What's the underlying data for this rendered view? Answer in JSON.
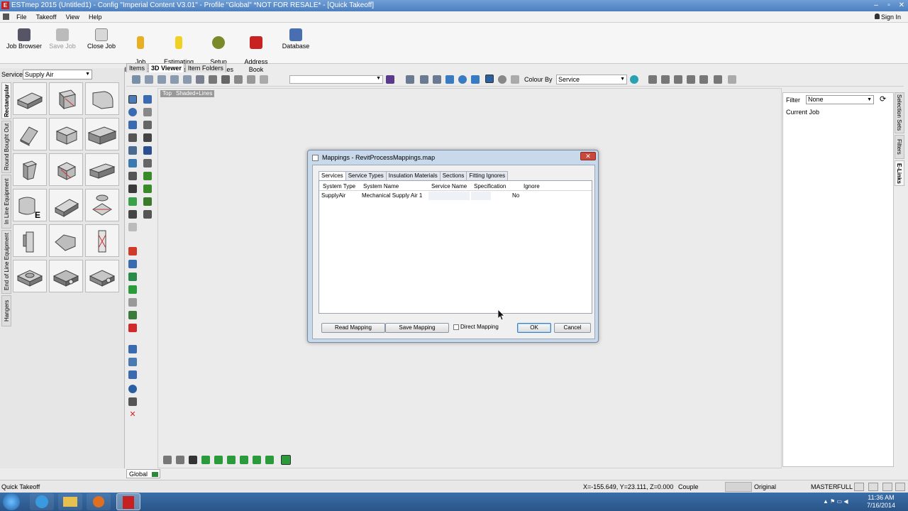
{
  "window": {
    "title": "ESTmep 2015 (Untitled1) - Config \"Imperial Content V3.01\" - Profile \"Global\" *NOT FOR RESALE* - [Quick Takeoff]",
    "controls": [
      "–",
      "▫",
      "✕"
    ]
  },
  "menu": {
    "items": [
      "File",
      "Takeoff",
      "View",
      "Help"
    ],
    "sign_in": "Sign In"
  },
  "ribbon": {
    "job_browser": "Job Browser",
    "save_job": "Save Job",
    "close_job": "Close Job",
    "job_information": "Job\nInformation",
    "estimating_summary": "Estimating\nSummary",
    "setup_processes": "Setup\nProcesses",
    "address_book": "Address\nBook",
    "database": "Database"
  },
  "left_panel": {
    "service_label": "Service",
    "service_value": "Supply Air",
    "vertical_tabs": [
      "Rectangular",
      "Round Bought Out",
      "In Line Equipment",
      "End of Line Equipment",
      "Hangers"
    ]
  },
  "view_tabs": [
    "Items",
    "3D Viewer",
    "Item Folders"
  ],
  "view_toolbar": {
    "colour_by_label": "Colour By",
    "colour_by_value": "Service"
  },
  "viewport": {
    "top_chip": "Top",
    "mode_chip": "Shaded+Lines"
  },
  "right_panel": {
    "filter_label": "Filter",
    "filter_value": "None",
    "current_job": "Current Job",
    "vertical_tabs": [
      "Selection Sets",
      "Filters",
      "E-Links"
    ]
  },
  "global_tab": "Global",
  "dialog": {
    "title": "Mappings - RevitProcessMappings.map",
    "tabs": [
      "Services",
      "Service Types",
      "Insulation Materials",
      "Sections",
      "Fitting Ignores"
    ],
    "columns": [
      "System Type",
      "System Name",
      "Service Name",
      "Specification",
      "Ignore"
    ],
    "rows": [
      {
        "system_type": "SupplyAir",
        "system_name": "Mechanical Supply Air 1",
        "service_name": "",
        "specification": "",
        "ignore": "No"
      }
    ],
    "read_mapping": "Read Mapping",
    "save_mapping": "Save Mapping",
    "direct_mapping": "Direct Mapping",
    "direct_mapping_checked": false,
    "ok": "OK",
    "cancel": "Cancel"
  },
  "status": {
    "mode": "Quick Takeoff",
    "coords": "X=-155.649, Y=23.111, Z=0.000",
    "couple": "Couple",
    "original": "Original",
    "master": "MASTER",
    "full": "FULL"
  },
  "taskbar": {
    "time": "11:36 AM",
    "date": "7/16/2014"
  }
}
